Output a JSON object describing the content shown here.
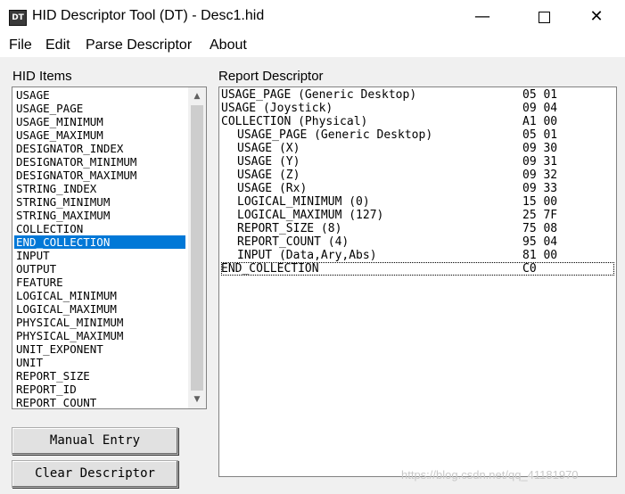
{
  "window": {
    "title": "HID Descriptor Tool (DT) - Desc1.hid",
    "icon_name": "app-icon",
    "icon_text": "DT",
    "controls": {
      "minimize": "—",
      "maximize": "□",
      "close": "✕"
    }
  },
  "menu": {
    "items": [
      "File",
      "Edit",
      "Parse Descriptor",
      "About"
    ]
  },
  "hid_items": {
    "label": "HID Items",
    "selected": "END_COLLECTION",
    "items": [
      "USAGE",
      "USAGE_PAGE",
      "USAGE_MINIMUM",
      "USAGE_MAXIMUM",
      "DESIGNATOR_INDEX",
      "DESIGNATOR_MINIMUM",
      "DESIGNATOR_MAXIMUM",
      "STRING_INDEX",
      "STRING_MINIMUM",
      "STRING_MAXIMUM",
      "COLLECTION",
      "END_COLLECTION",
      "INPUT",
      "OUTPUT",
      "FEATURE",
      "LOGICAL_MINIMUM",
      "LOGICAL_MAXIMUM",
      "PHYSICAL_MINIMUM",
      "PHYSICAL_MAXIMUM",
      "UNIT_EXPONENT",
      "UNIT",
      "REPORT_SIZE",
      "REPORT_ID",
      "REPORT_COUNT"
    ],
    "scroll_up": "▲",
    "scroll_down": "▼"
  },
  "buttons": {
    "manual_entry": "Manual Entry",
    "clear_descriptor": "Clear Descriptor"
  },
  "report_descriptor": {
    "label": "Report Descriptor",
    "lines": [
      {
        "item": "USAGE_PAGE (Generic Desktop)",
        "code": "05 01",
        "indent": 0
      },
      {
        "item": "USAGE (Joystick)",
        "code": "09 04",
        "indent": 0
      },
      {
        "item": "COLLECTION (Physical)",
        "code": "A1 00",
        "indent": 0
      },
      {
        "item": "USAGE_PAGE (Generic Desktop)",
        "code": "05 01",
        "indent": 1
      },
      {
        "item": "USAGE (X)",
        "code": "09 30",
        "indent": 1
      },
      {
        "item": "USAGE (Y)",
        "code": "09 31",
        "indent": 1
      },
      {
        "item": "USAGE (Z)",
        "code": "09 32",
        "indent": 1
      },
      {
        "item": "USAGE (Rx)",
        "code": "09 33",
        "indent": 1
      },
      {
        "item": "LOGICAL_MINIMUM (0)",
        "code": "15 00",
        "indent": 1
      },
      {
        "item": "LOGICAL_MAXIMUM (127)",
        "code": "25 7F",
        "indent": 1
      },
      {
        "item": "REPORT_SIZE (8)",
        "code": "75 08",
        "indent": 1
      },
      {
        "item": "REPORT_COUNT (4)",
        "code": "95 04",
        "indent": 1
      },
      {
        "item": "INPUT (Data,Ary,Abs)",
        "code": "81 00",
        "indent": 1
      },
      {
        "item": "END_COLLECTION",
        "code": "C0",
        "indent": 0
      }
    ],
    "focused_index": 13
  },
  "watermark": "https://blog.csdn.net/qq_41181970"
}
